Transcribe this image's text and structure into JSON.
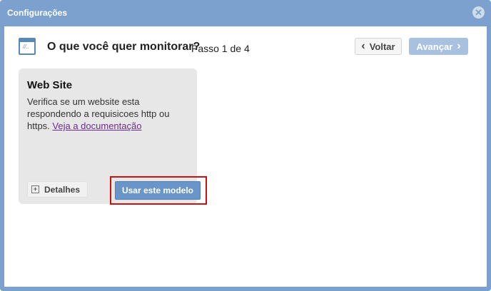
{
  "dialog": {
    "title": "Configurações",
    "close_icon": "close-icon"
  },
  "wizard": {
    "icon": "website-template-icon",
    "question": "O que você quer monitorar?",
    "step": "Passo 1 de 4",
    "back_label": "Voltar",
    "next_label": "Avançar"
  },
  "template_card": {
    "title": "Web Site",
    "description": "Verifica se um website esta respondendo a requisicoes http ou https.",
    "doc_link": "Veja a documentação",
    "details_label": "Detalhes",
    "use_label": "Usar este modelo"
  },
  "colors": {
    "frame": "#7da1cf",
    "primary_button": "#6a95c8",
    "disabled_button": "#a9c1e0",
    "highlight": "#cc1111",
    "link": "#6b2d8f"
  }
}
